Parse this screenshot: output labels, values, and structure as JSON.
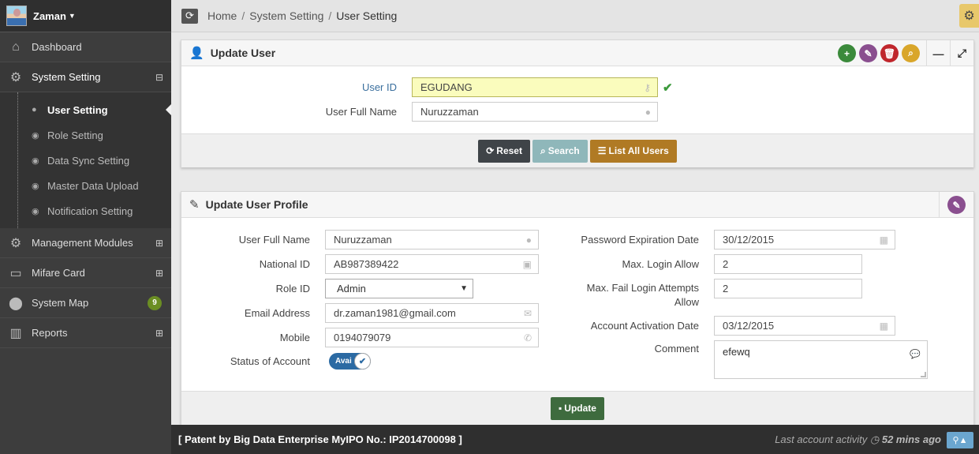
{
  "user": {
    "name": "Zaman"
  },
  "sidebar": {
    "items": [
      {
        "label": "Dashboard",
        "icon": "home-icon"
      },
      {
        "label": "System Setting",
        "icon": "gears-icon",
        "expander": "⊟"
      },
      {
        "label": "Management Modules",
        "icon": "gears-icon",
        "expander": "⊞"
      },
      {
        "label": "Mifare Card",
        "icon": "card-icon",
        "expander": "⊞"
      },
      {
        "label": "System Map",
        "icon": "map-marker-icon",
        "badge": "9"
      },
      {
        "label": "Reports",
        "icon": "bar-chart-icon",
        "expander": "⊞"
      }
    ],
    "submenu": [
      {
        "label": "User Setting",
        "icon": "user-icon"
      },
      {
        "label": "Role Setting",
        "icon": "eye-icon"
      },
      {
        "label": "Data Sync Setting",
        "icon": "eye-icon"
      },
      {
        "label": "Master Data Upload",
        "icon": "eye-icon"
      },
      {
        "label": "Notification Setting",
        "icon": "eye-icon"
      }
    ]
  },
  "breadcrumb": [
    "Home",
    "System Setting",
    "User Setting"
  ],
  "update_user": {
    "title": "Update User",
    "user_id_label": "User ID",
    "user_id_value": "EGUDANG",
    "full_name_label": "User Full Name",
    "full_name_value": "Nuruzzaman",
    "reset_label": "Reset",
    "search_label": "Search",
    "list_label": "List All Users"
  },
  "profile": {
    "title": "Update User Profile",
    "full_name_label": "User Full Name",
    "full_name_value": "Nuruzzaman",
    "national_id_label": "National ID",
    "national_id_value": "AB987389422",
    "role_label": "Role ID",
    "role_value": "Admin",
    "email_label": "Email Address",
    "email_value": "dr.zaman1981@gmail.com",
    "mobile_label": "Mobile",
    "mobile_value": "0194079079",
    "status_label": "Status of Account",
    "status_value": "Avai",
    "pwd_exp_label": "Password Expiration Date",
    "pwd_exp_value": "30/12/2015",
    "max_login_label": "Max. Login Allow",
    "max_login_value": "2",
    "max_fail_label_1": "Max. Fail Login Attempts",
    "max_fail_label_2": "Allow",
    "max_fail_value": "2",
    "activation_label": "Account Activation Date",
    "activation_value": "03/12/2015",
    "comment_label": "Comment",
    "comment_value": "efewq",
    "update_label": "Update"
  },
  "footer": {
    "patent": "[ Patent by Big Data Enterprise   MyIPO No.: IP2014700098 ]",
    "activity_text": "Last account activity",
    "activity_time": "52 mins ago"
  },
  "colors": {
    "sidebar_bg": "#3d3d3d",
    "add": "#3b8a3b",
    "edit": "#8a4f8f",
    "delete": "#c0262c",
    "search": "#d9a62a",
    "reset_btn": "#3f4448",
    "search_btn": "#8fb7ba",
    "list_btn": "#b07a24",
    "update_btn": "#3e6b3e"
  }
}
